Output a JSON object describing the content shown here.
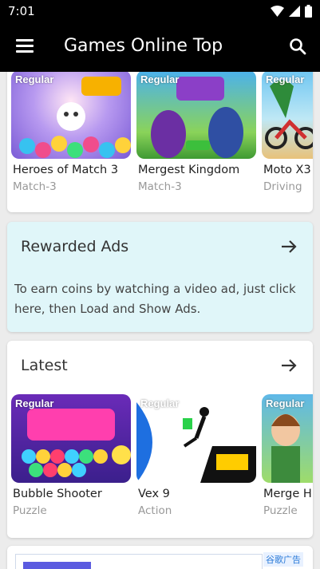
{
  "status_bar": {
    "time": "7:01"
  },
  "app_bar": {
    "title": "Games Online Top"
  },
  "featured": {
    "games": [
      {
        "name": "Heroes of Match 3",
        "genre": "Match-3",
        "tag": "Regular"
      },
      {
        "name": "Mergest Kingdom",
        "genre": "Match-3",
        "tag": "Regular"
      },
      {
        "name": "Moto X3",
        "genre": "Driving",
        "tag": "Regular"
      }
    ]
  },
  "rewarded": {
    "title": "Rewarded Ads",
    "description": "To earn coins by watching a video ad, just click here, then Load and Show Ads."
  },
  "latest": {
    "title": "Latest",
    "games": [
      {
        "name": "Bubble Shooter",
        "genre": "Puzzle",
        "tag": "Regular"
      },
      {
        "name": "Vex 9",
        "genre": "Action",
        "tag": "Regular"
      },
      {
        "name": "Merge H",
        "genre": "Puzzle",
        "tag": "Regular"
      }
    ]
  },
  "ad": {
    "label": "谷歌广告"
  },
  "colors": {
    "app_bar": "#000000",
    "rewarded_bg": "#e0f6f9",
    "page_bg": "#ececec"
  }
}
